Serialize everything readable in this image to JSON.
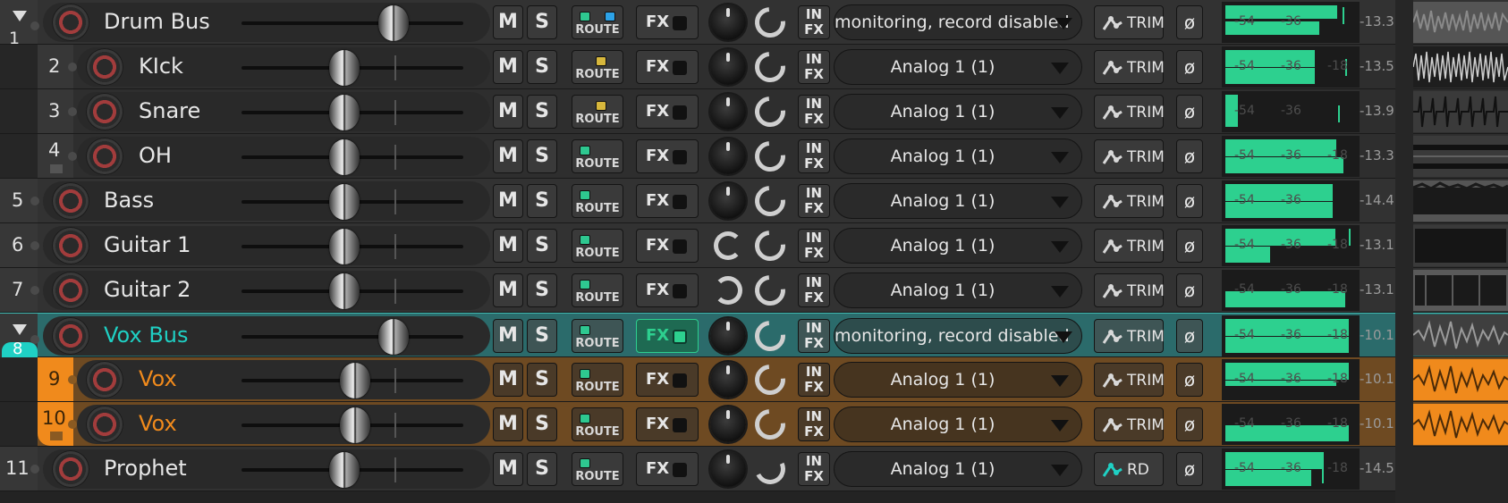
{
  "colors": {
    "meter_green": "#2dd08f",
    "vox_bus_teal": "#1fd0c4",
    "vox_orange": "#f08a1c",
    "record_red": "#a23c3c"
  },
  "tracks": [
    {
      "number": "1",
      "name": "Drum Bus",
      "mute": "M",
      "solo": "S",
      "route": "ROUTE",
      "fx": "FX",
      "input_fx": [
        "IN",
        "FX"
      ],
      "input": "monitoring, record disabled",
      "automation": "TRIM",
      "phase": "ø",
      "peak": "-13.3",
      "scale": [
        "-54",
        "-36"
      ]
    },
    {
      "number": "2",
      "name": "KIck",
      "mute": "M",
      "solo": "S",
      "route": "ROUTE",
      "fx": "FX",
      "input_fx": [
        "IN",
        "FX"
      ],
      "input": "Analog 1 (1)",
      "automation": "TRIM",
      "phase": "ø",
      "peak": "-13.5",
      "scale": [
        "-54",
        "-36",
        "-18"
      ]
    },
    {
      "number": "3",
      "name": "Snare",
      "mute": "M",
      "solo": "S",
      "route": "ROUTE",
      "fx": "FX",
      "input_fx": [
        "IN",
        "FX"
      ],
      "input": "Analog 1 (1)",
      "automation": "TRIM",
      "phase": "ø",
      "peak": "-13.9",
      "scale": [
        "-54",
        "-36"
      ]
    },
    {
      "number": "4",
      "name": "OH",
      "mute": "M",
      "solo": "S",
      "route": "ROUTE",
      "fx": "FX",
      "input_fx": [
        "IN",
        "FX"
      ],
      "input": "Analog 1 (1)",
      "automation": "TRIM",
      "phase": "ø",
      "peak": "-13.3",
      "scale": [
        "-54",
        "-36",
        "-18"
      ]
    },
    {
      "number": "5",
      "name": "Bass",
      "mute": "M",
      "solo": "S",
      "route": "ROUTE",
      "fx": "FX",
      "input_fx": [
        "IN",
        "FX"
      ],
      "input": "Analog 1 (1)",
      "automation": "TRIM",
      "phase": "ø",
      "peak": "-14.4",
      "scale": [
        "-54",
        "-36"
      ]
    },
    {
      "number": "6",
      "name": "Guitar 1",
      "mute": "M",
      "solo": "S",
      "route": "ROUTE",
      "fx": "FX",
      "input_fx": [
        "IN",
        "FX"
      ],
      "input": "Analog 1 (1)",
      "automation": "TRIM",
      "phase": "ø",
      "peak": "-13.1",
      "scale": [
        "-54",
        "-36",
        "-18"
      ]
    },
    {
      "number": "7",
      "name": "Guitar 2",
      "mute": "M",
      "solo": "S",
      "route": "ROUTE",
      "fx": "FX",
      "input_fx": [
        "IN",
        "FX"
      ],
      "input": "Analog 1 (1)",
      "automation": "TRIM",
      "phase": "ø",
      "peak": "-13.1",
      "scale": [
        "-54",
        "-36",
        "-18"
      ]
    },
    {
      "number": "8",
      "name": "Vox Bus",
      "mute": "M",
      "solo": "S",
      "route": "ROUTE",
      "fx": "FX",
      "input_fx": [
        "IN",
        "FX"
      ],
      "input": "monitoring, record disabled",
      "automation": "TRIM",
      "phase": "ø",
      "peak": "-10.1",
      "scale": [
        "-54",
        "-36",
        "-18"
      ]
    },
    {
      "number": "9",
      "name": "Vox",
      "mute": "M",
      "solo": "S",
      "route": "ROUTE",
      "fx": "FX",
      "input_fx": [
        "IN",
        "FX"
      ],
      "input": "Analog 1 (1)",
      "automation": "TRIM",
      "phase": "ø",
      "peak": "-10.1",
      "scale": [
        "-54",
        "-36",
        "-18"
      ]
    },
    {
      "number": "10",
      "name": "Vox",
      "mute": "M",
      "solo": "S",
      "route": "ROUTE",
      "fx": "FX",
      "input_fx": [
        "IN",
        "FX"
      ],
      "input": "Analog 1 (1)",
      "automation": "TRIM",
      "phase": "ø",
      "peak": "-10.1",
      "scale": [
        "-54",
        "-36",
        "-18"
      ]
    },
    {
      "number": "11",
      "name": "Prophet",
      "mute": "M",
      "solo": "S",
      "route": "ROUTE",
      "fx": "FX",
      "input_fx": [
        "IN",
        "FX"
      ],
      "input": "Analog 1 (1)",
      "automation": "RD",
      "phase": "ø",
      "peak": "-14.5",
      "scale": [
        "-54",
        "-36",
        "-18"
      ]
    }
  ]
}
